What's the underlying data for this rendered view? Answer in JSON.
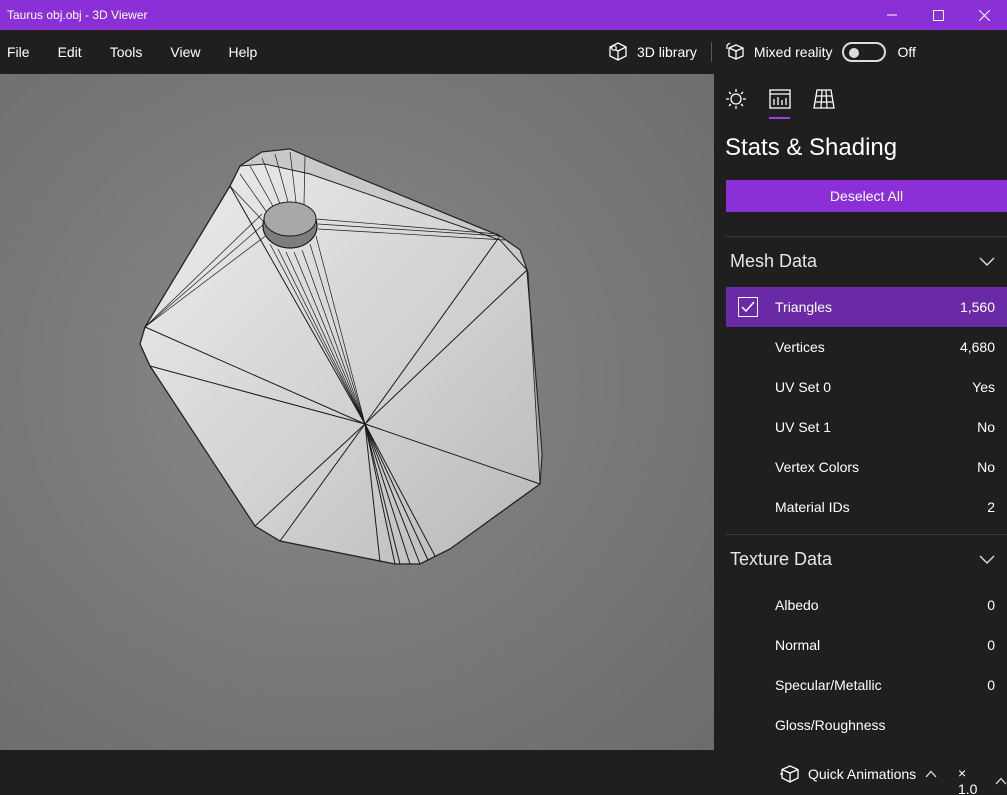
{
  "window": {
    "title": "Taurus obj.obj - 3D Viewer"
  },
  "menu": {
    "items": [
      "File",
      "Edit",
      "Tools",
      "View",
      "Help"
    ],
    "library_label": "3D library",
    "mixed_reality_label": "Mixed reality",
    "toggle_state": "Off"
  },
  "panel": {
    "title": "Stats & Shading",
    "deselect_label": "Deselect All",
    "mesh_section": "Mesh Data",
    "mesh_rows": [
      {
        "label": "Triangles",
        "value": "1,560",
        "checked": true
      },
      {
        "label": "Vertices",
        "value": "4,680"
      },
      {
        "label": "UV Set 0",
        "value": "Yes"
      },
      {
        "label": "UV Set 1",
        "value": "No"
      },
      {
        "label": "Vertex Colors",
        "value": "No"
      },
      {
        "label": "Material IDs",
        "value": "2"
      }
    ],
    "texture_section": "Texture Data",
    "texture_rows": [
      {
        "label": "Albedo",
        "value": "0"
      },
      {
        "label": "Normal",
        "value": "0"
      },
      {
        "label": "Specular/Metallic",
        "value": "0"
      },
      {
        "label": "Gloss/Roughness",
        "value": ""
      }
    ]
  },
  "bottom": {
    "quick_animations_label": "Quick Animations",
    "speed_label": "× 1.0"
  },
  "colors": {
    "accent": "#8b2fd6",
    "selected_row": "#6a2aa6",
    "background": "#1f1f1f"
  }
}
